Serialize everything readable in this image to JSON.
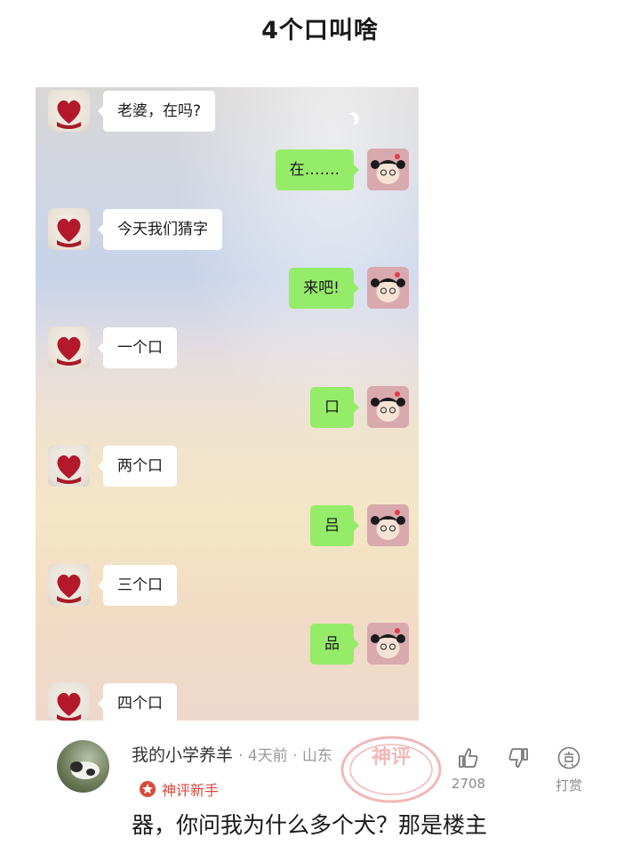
{
  "post": {
    "title": "4个口叫啥"
  },
  "chat": {
    "messages": [
      {
        "side": "left",
        "text": "老婆，在吗?"
      },
      {
        "side": "right",
        "text": "在……."
      },
      {
        "side": "left",
        "text": "今天我们猜字"
      },
      {
        "side": "right",
        "text": "来吧!"
      },
      {
        "side": "left",
        "text": "一个口"
      },
      {
        "side": "right",
        "text": "口"
      },
      {
        "side": "left",
        "text": "两个口"
      },
      {
        "side": "right",
        "text": "吕"
      },
      {
        "side": "left",
        "text": "三个口"
      },
      {
        "side": "right",
        "text": "品"
      },
      {
        "side": "left",
        "text": "四个口"
      }
    ]
  },
  "comment": {
    "username": "我的小学养羊",
    "meta": "· 4天前 · 山东",
    "badge": "神评新手",
    "text": "器，你问我为什么多个犬？那是楼主",
    "like_count": "2708",
    "tip_label": "打赏",
    "stamp_text": "神评"
  },
  "colors": {
    "bubble_right": "#95ec69",
    "bubble_left": "#ffffff",
    "badge": "#d6493d"
  },
  "icons": {
    "left_avatar": "heart-avatar-icon",
    "right_avatar": "girl-avatar-icon",
    "like": "thumb-up-icon",
    "dislike": "thumb-down-icon",
    "tip": "reward-icon"
  }
}
